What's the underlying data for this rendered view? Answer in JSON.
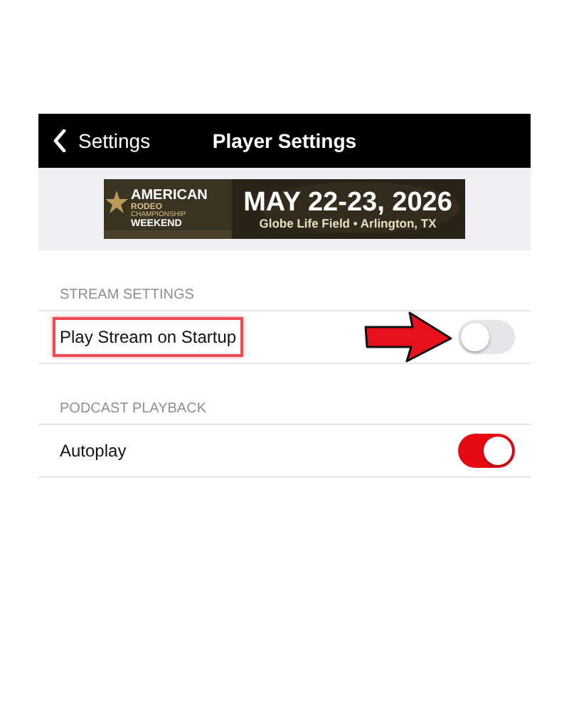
{
  "nav": {
    "back": "Settings",
    "title": "Player Settings"
  },
  "banner": {
    "brand_top": "AMERICAN",
    "brand_mid": "RODEO",
    "brand_small": "CHAMPIONSHIP",
    "brand_bottom": "WEEKEND",
    "date": "MAY 22-23, 2026",
    "venue": "Globe Life Field • Arlington, TX"
  },
  "sections": [
    {
      "header": "STREAM SETTINGS",
      "rows": [
        {
          "label": "Play Stream on Startup",
          "on": false,
          "highlighted": true,
          "arrow": true
        }
      ]
    },
    {
      "header": "PODCAST PLAYBACK",
      "rows": [
        {
          "label": "Autoplay",
          "on": true,
          "highlighted": false,
          "arrow": false
        }
      ]
    }
  ]
}
